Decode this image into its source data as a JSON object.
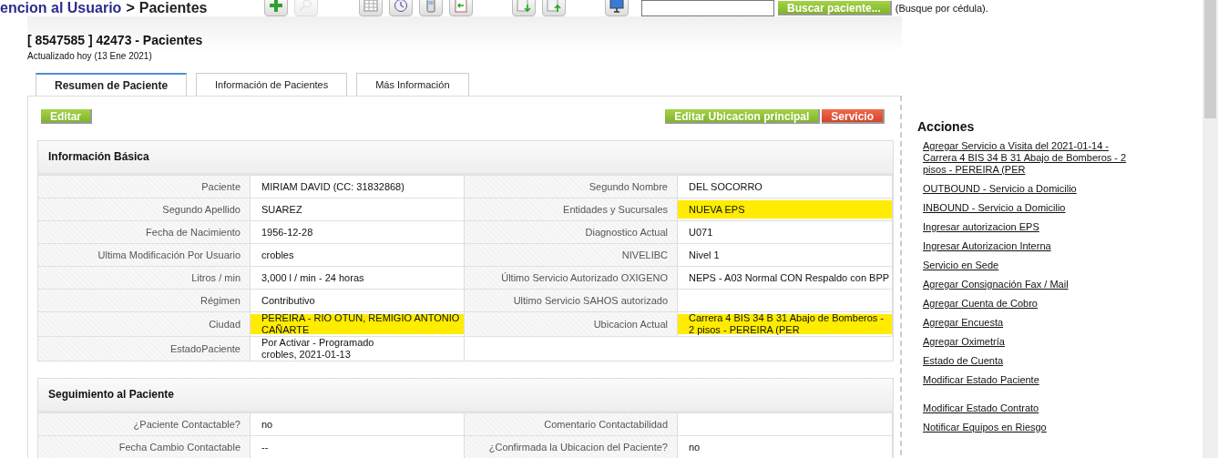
{
  "header": {
    "section": "encion al Usuario",
    "separator": ">",
    "page": "Pacientes"
  },
  "toolbar": [
    [
      {
        "kind": "plus",
        "disabled": false
      },
      {
        "kind": "search",
        "disabled": true
      }
    ],
    [
      {
        "kind": "table",
        "disabled": false
      },
      {
        "kind": "clock",
        "disabled": false
      },
      {
        "kind": "phone",
        "disabled": false
      },
      {
        "kind": "document",
        "disabled": false
      }
    ],
    [
      {
        "kind": "download",
        "disabled": false
      },
      {
        "kind": "upload",
        "disabled": false
      }
    ],
    [
      {
        "kind": "monitor",
        "disabled": false
      }
    ]
  ],
  "search": {
    "button": "Buscar paciente...",
    "hint": "(Busque por cédula)."
  },
  "record": {
    "title": "[ 8547585 ] 42473 - Pacientes",
    "updated": "Actualizado hoy (13 Ene 2021)"
  },
  "tabs": [
    {
      "label": "Resumen de Paciente",
      "selected": true
    },
    {
      "label": "Información de Pacientes",
      "selected": false
    },
    {
      "label": "Más Información",
      "selected": false
    }
  ],
  "left_buttons": [
    {
      "label": "Editar",
      "kind": "primary"
    }
  ],
  "right_buttons": [
    {
      "label": "Editar Ubicacion principal",
      "kind": "primary"
    },
    {
      "label": "Servicio",
      "kind": "danger"
    }
  ],
  "sections": [
    {
      "title": "Información Básica",
      "rows": [
        {
          "left": {
            "label": "Paciente",
            "value": "MIRIAM DAVID (CC: 31832868)",
            "highlighted": false
          },
          "right": {
            "label": "Segundo Nombre",
            "value": "DEL SOCORRO",
            "highlighted": false
          }
        },
        {
          "left": {
            "label": "Segundo Apellido",
            "value": "SUAREZ",
            "highlighted": false
          },
          "right": {
            "label": "Entidades y Sucursales",
            "value": "NUEVA EPS",
            "highlighted": true
          }
        },
        {
          "left": {
            "label": "Fecha de Nacimiento",
            "value": "1956-12-28",
            "highlighted": false
          },
          "right": {
            "label": "Diagnostico Actual",
            "value": "U071",
            "highlighted": false
          }
        },
        {
          "left": {
            "label": "Ultima Modificación Por Usuario",
            "value": "crobles",
            "highlighted": false
          },
          "right": {
            "label": "NIVELIBC",
            "value": "Nivel 1",
            "highlighted": false
          }
        },
        {
          "left": {
            "label": "Litros / min",
            "value": "3,000 l / min - 24 horas",
            "highlighted": false
          },
          "right": {
            "label": "Último Servicio Autorizado OXIGENO",
            "value": "NEPS - A03 Normal CON Respaldo con BPP",
            "highlighted": false
          }
        },
        {
          "left": {
            "label": "Régimen",
            "value": "Contributivo",
            "highlighted": false
          },
          "right": {
            "label": "Ultimo Servicio SAHOS autorizado",
            "highlighted": false
          }
        },
        {
          "left": {
            "label": "Ciudad",
            "value": "PEREIRA - RIO OTUN, REMIGIO ANTONIO CAÑARTE",
            "highlighted": true
          },
          "right": {
            "label": "Ubicacion Actual",
            "value": "Carrera 4 BIS 34 B 31 Abajo de Bomberos - 2 pisos - PEREIRA (PER",
            "highlighted": true
          }
        },
        {
          "left": {
            "label": "EstadoPaciente",
            "value": "Por Activar - Programado",
            "note": "crobles, 2021-01-13",
            "highlighted": false
          }
        }
      ]
    },
    {
      "title": "Seguimiento al Paciente",
      "rows": [
        {
          "left": {
            "label": "¿Paciente Contactable?",
            "value": "no",
            "highlighted": false
          },
          "right": {
            "label": "Comentario Contactabilidad",
            "highlighted": false
          }
        },
        {
          "left": {
            "label": "Fecha Cambio Contactable",
            "value": "--",
            "highlighted": false
          },
          "right": {
            "label": "¿Confirmada la Ubicacion del Paciente?",
            "value": "no",
            "highlighted": false
          }
        }
      ]
    }
  ],
  "actions": {
    "title": "Acciones",
    "groups": [
      [
        "Agregar Servicio a Visita del 2021-01-14 - Carrera 4 BIS 34 B 31 Abajo de Bomberos - 2 pisos - PEREIRA (PER",
        "OUTBOUND - Servicio a Domicilio",
        "INBOUND - Servicio a Domicilio",
        "Ingresar autorizacion EPS",
        "Ingresar Autorizacion Interna",
        "Servicio en Sede",
        "Agregar Consignación Fax / Mail",
        "Agregar Cuenta de Cobro",
        "Agregar Encuesta",
        "Agregar Oximetría",
        "Estado de Cuenta",
        "Modificar Estado Paciente"
      ],
      [
        "Modificar Estado Contrato",
        "Notificar Equipos en Riesgo"
      ]
    ]
  }
}
